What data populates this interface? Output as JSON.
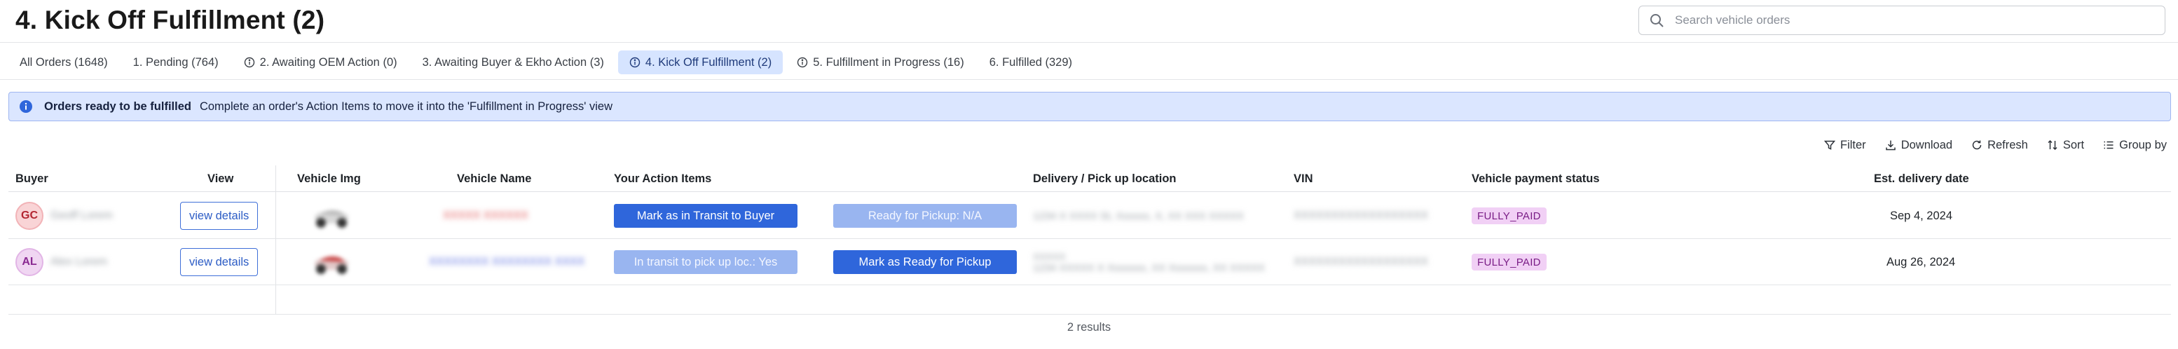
{
  "page": {
    "title": "4. Kick Off Fulfillment (2)"
  },
  "search": {
    "placeholder": "Search vehicle orders"
  },
  "tabs": [
    {
      "label": "All Orders (1648)",
      "info": false,
      "active": false
    },
    {
      "label": "1. Pending (764)",
      "info": false,
      "active": false
    },
    {
      "label": "2. Awaiting OEM Action (0)",
      "info": true,
      "active": false
    },
    {
      "label": "3. Awaiting Buyer & Ekho Action (3)",
      "info": false,
      "active": false
    },
    {
      "label": "4. Kick Off Fulfillment (2)",
      "info": true,
      "active": true
    },
    {
      "label": "5. Fulfillment in Progress (16)",
      "info": true,
      "active": false
    },
    {
      "label": "6. Fulfilled (329)",
      "info": false,
      "active": false
    }
  ],
  "banner": {
    "title": "Orders ready to be fulfilled",
    "text": "Complete an order's Action Items to move it into the 'Fulfillment in Progress' view",
    "icon": "info-icon"
  },
  "toolbar": {
    "filter": "Filter",
    "download": "Download",
    "refresh": "Refresh",
    "sort": "Sort",
    "group_by": "Group by"
  },
  "table": {
    "columns": {
      "buyer": "Buyer",
      "view": "View",
      "vehicle_img": "Vehicle Img",
      "vehicle_name": "Vehicle Name",
      "action_items": "Your Action Items",
      "location": "Delivery / Pick up location",
      "vin": "VIN",
      "payment_status": "Vehicle payment status",
      "delivery_date": "Est. delivery date"
    },
    "rows": [
      {
        "initials": "GC",
        "buyer_name": "Geoff Lorem",
        "view_label": "view details",
        "vehicle_name": "XXXXX XXXXXX",
        "action_1": "Mark as in Transit to Buyer",
        "action_2": "Ready for Pickup: N/A",
        "location": "1234 X XXXX St, Xxxxxx, X, XX XXX XXXXX",
        "vin": "XXXXXXXXXXXXXXXXXX",
        "payment_status": "FULLY_PAID",
        "delivery_date": "Sep 4, 2024"
      },
      {
        "initials": "AL",
        "buyer_name": "Alex Lorem",
        "view_label": "view details",
        "vehicle_name": "XXXXXXXX XXXXXXXX XXXX",
        "action_1": "In transit to pick up loc.: Yes",
        "action_2": "Mark as Ready for Pickup",
        "location_line1": "XXXXX",
        "location": "1234 XXXXX X Xxxxxxx, XX Xxxxxxx, XX XXXXX",
        "vin": "XXXXXXXXXXXXXXXXXX",
        "payment_status": "FULLY_PAID",
        "delivery_date": "Aug 26, 2024"
      }
    ]
  },
  "footer": {
    "results": "2 results"
  },
  "colors": {
    "primary_button": "#2f66db",
    "disabled_button": "#99b5f0",
    "active_tab_bg": "#d6e4ff",
    "banner_bg": "#dbe6ff",
    "badge_bg": "#f1d0f5"
  }
}
